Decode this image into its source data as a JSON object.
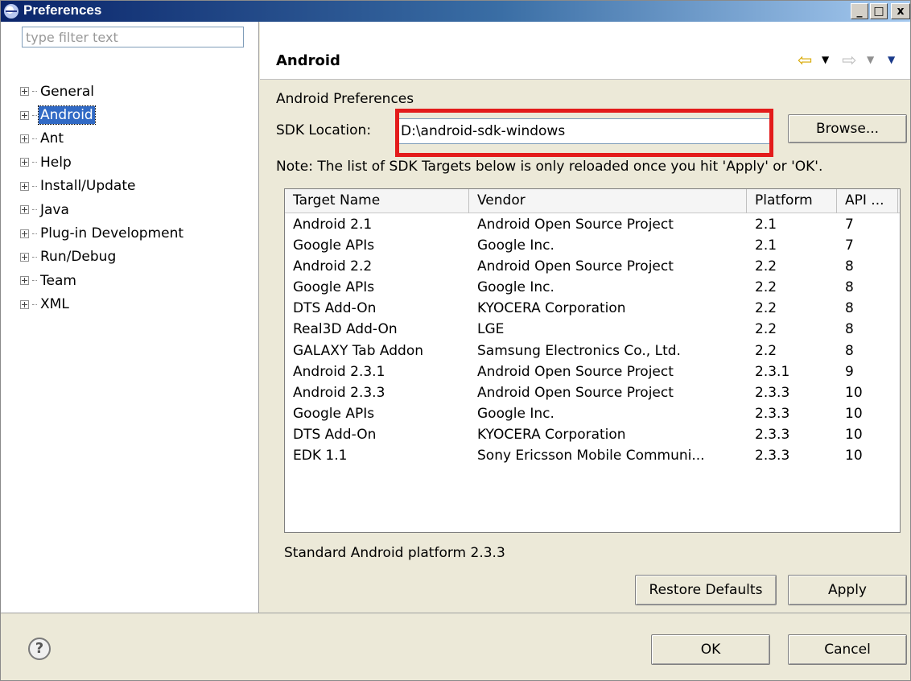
{
  "window": {
    "title": "Preferences",
    "minimize": "_",
    "maximize": "□",
    "close": "x"
  },
  "left": {
    "filter_placeholder": "type filter text",
    "tree": [
      "General",
      "Android",
      "Ant",
      "Help",
      "Install/Update",
      "Java",
      "Plug-in Development",
      "Run/Debug",
      "Team",
      "XML"
    ],
    "selected": "Android"
  },
  "page": {
    "title": "Android",
    "section_title": "Android Preferences",
    "sdk_label": "SDK Location:",
    "sdk_value": "D:\\android-sdk-windows",
    "browse_label": "Browse...",
    "note": "Note: The list of SDK Targets below is only reloaded once you hit 'Apply' or 'OK'.",
    "table": {
      "headers": [
        "Target Name",
        "Vendor",
        "Platform",
        "API ..."
      ],
      "rows": [
        [
          "Android 2.1",
          "Android Open Source Project",
          "2.1",
          "7"
        ],
        [
          "Google APIs",
          "Google Inc.",
          "2.1",
          "7"
        ],
        [
          "Android 2.2",
          "Android Open Source Project",
          "2.2",
          "8"
        ],
        [
          "Google APIs",
          "Google Inc.",
          "2.2",
          "8"
        ],
        [
          "DTS Add-On",
          "KYOCERA Corporation",
          "2.2",
          "8"
        ],
        [
          "Real3D Add-On",
          "LGE",
          "2.2",
          "8"
        ],
        [
          "GALAXY Tab Addon",
          "Samsung Electronics Co., Ltd.",
          "2.2",
          "8"
        ],
        [
          "Android 2.3.1",
          "Android Open Source Project",
          "2.3.1",
          "9"
        ],
        [
          "Android 2.3.3",
          "Android Open Source Project",
          "2.3.3",
          "10"
        ],
        [
          "Google APIs",
          "Google Inc.",
          "2.3.3",
          "10"
        ],
        [
          "DTS Add-On",
          "KYOCERA Corporation",
          "2.3.3",
          "10"
        ],
        [
          "EDK 1.1",
          "Sony Ericsson Mobile Communi...",
          "2.3.3",
          "10"
        ]
      ]
    },
    "description": "Standard Android platform 2.3.3",
    "restore_label": "Restore Defaults",
    "apply_label": "Apply"
  },
  "footer": {
    "help": "?",
    "ok_label": "OK",
    "cancel_label": "Cancel"
  },
  "colors": {
    "highlight": "#e31b1b",
    "selection": "#316ac5",
    "titlebar": "#0a246a"
  },
  "icons": {
    "app": "eclipse-icon",
    "back": "back-arrow-icon",
    "forward": "forward-arrow-icon",
    "help": "help-icon"
  }
}
